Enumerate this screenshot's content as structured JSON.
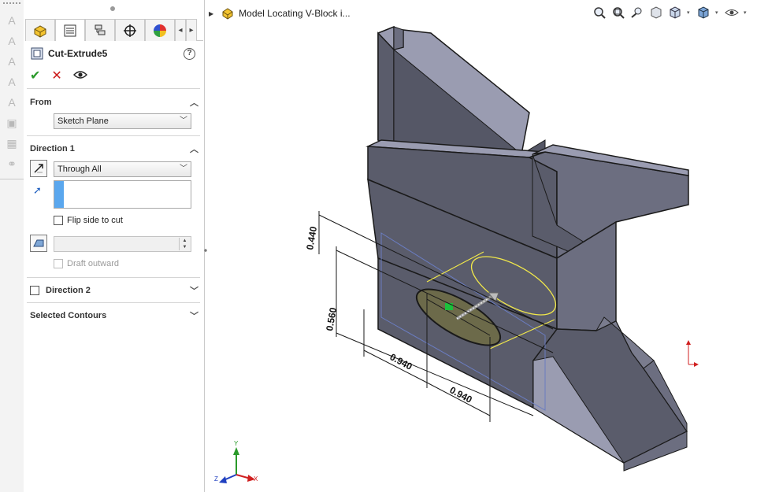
{
  "document": {
    "title": "Model Locating V-Block i..."
  },
  "property_manager": {
    "feature_name": "Cut-Extrude5",
    "help_label": "?",
    "from_section": {
      "label": "From",
      "selected": "Sketch Plane"
    },
    "direction1": {
      "label": "Direction 1",
      "end_condition": "Through All",
      "flip_side_label": "Flip side to cut",
      "flip_side_checked": false,
      "draft_outward_label": "Draft outward",
      "draft_outward_checked": false,
      "draft_outward_enabled": false
    },
    "direction2": {
      "label": "Direction 2",
      "checked": false
    },
    "selected_contours": {
      "label": "Selected Contours"
    }
  },
  "tabs": [
    {
      "name": "feature-manager-tab",
      "icon": "feature-tree-icon",
      "active": false
    },
    {
      "name": "property-manager-tab",
      "icon": "property-manager-icon",
      "active": true
    },
    {
      "name": "configuration-manager-tab",
      "icon": "configuration-icon",
      "active": false
    },
    {
      "name": "dimxpert-manager-tab",
      "icon": "crosshair-icon",
      "active": false
    },
    {
      "name": "display-manager-tab",
      "icon": "display-pie-icon",
      "active": false
    }
  ],
  "dimensions": [
    {
      "label": "0.440"
    },
    {
      "label": "0.560"
    },
    {
      "label": "0.940"
    },
    {
      "label": "0.940"
    }
  ],
  "triad": {
    "x": "X",
    "y": "Y",
    "z": "Z"
  },
  "colors": {
    "model_face_top": "#9a9cb1",
    "model_face_front": "#5a5c6b",
    "model_face_side": "#6c6e80",
    "sketch_yellow": "#f1e84a",
    "slot_fill": "#6c6a4a",
    "accept_green": "#2a9a2a",
    "cancel_red": "#cc1a1a",
    "selection_blue": "#5aa7ee"
  }
}
